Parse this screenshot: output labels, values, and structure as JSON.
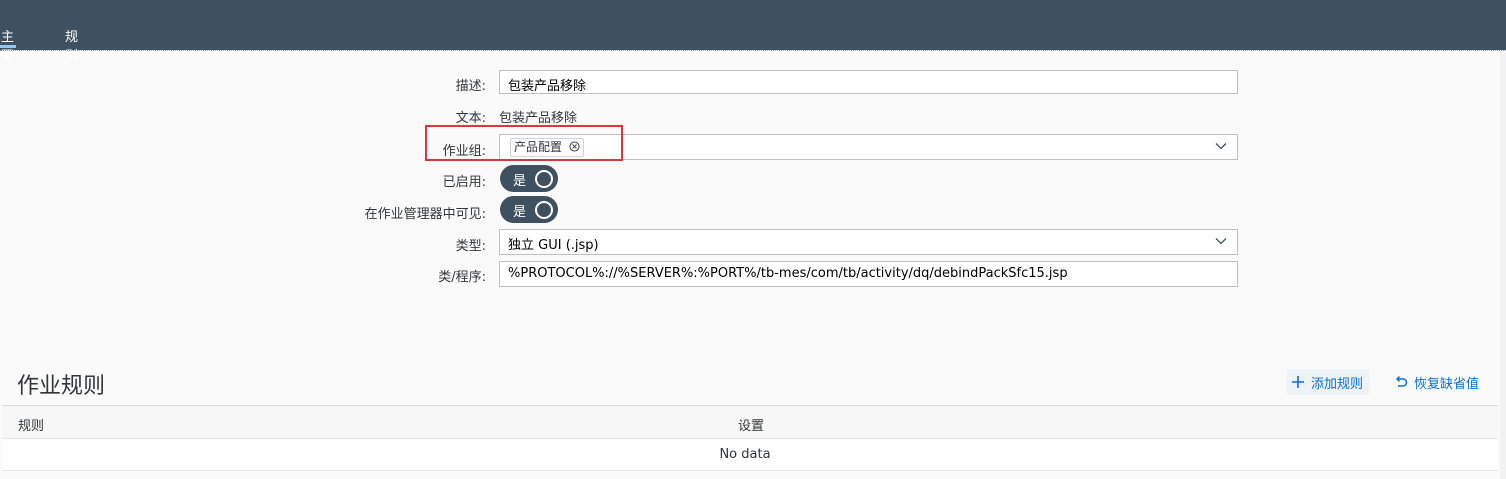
{
  "tabs": [
    {
      "label": "主要",
      "active": true
    },
    {
      "label": "规则",
      "active": false
    }
  ],
  "form": {
    "description_label": "描述:",
    "description_value": "包装产品移除",
    "text_label": "文本:",
    "text_value": "包装产品移除",
    "activity_group_label": "作业组:",
    "activity_group_tokens": [
      "产品配置"
    ],
    "enabled_label": "已启用:",
    "enabled_value": "是",
    "visible_label": "在作业管理器中可见:",
    "visible_value": "是",
    "type_label": "类型:",
    "type_value": "独立 GUI (.jsp)",
    "class_label": "类/程序:",
    "class_value": "%PROTOCOL%://%SERVER%:%PORT%/tb-mes/com/tb/activity/dq/debindPackSfc15.jsp"
  },
  "rules": {
    "title": "作业规则",
    "add_label": "添加规则",
    "restore_label": "恢复缺省值",
    "columns": [
      "规则",
      "设置"
    ],
    "empty_text": "No data"
  },
  "colors": {
    "header_bg": "#3f5161",
    "switch_bg": "#3f5161",
    "accent": "#0a6ed1",
    "highlight_border": "#d9363e"
  }
}
